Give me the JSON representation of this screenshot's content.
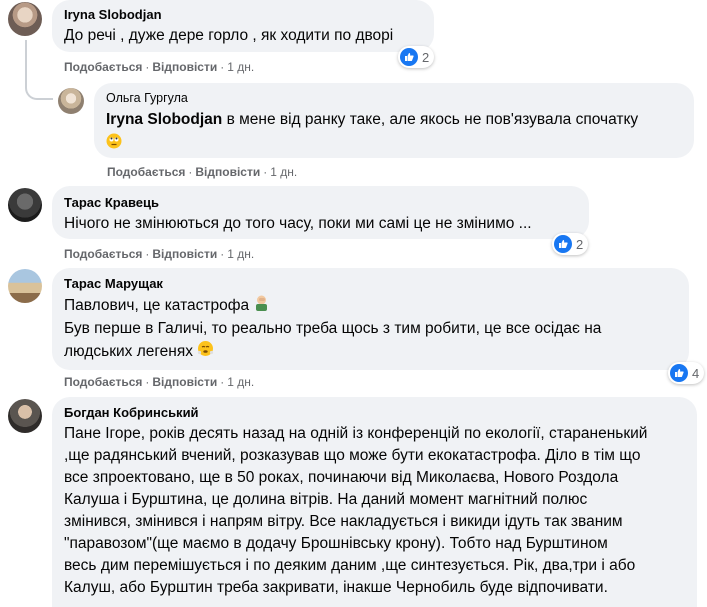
{
  "comments": [
    {
      "author": "Iryna Slobodjan",
      "lines": [
        "До речі , дуже дере горло , як ходити по дворі"
      ],
      "actions": {
        "like": "Подобається",
        "reply": "Відповісти",
        "time": "1 дн."
      },
      "reactions": "2"
    },
    {
      "author": "Ольга Гургула",
      "mention": "Iryna Slobodjan",
      "lines": [
        " в мене від ранку таке, але якось не пов'язувала спочатку"
      ],
      "emoji": "face-with-rolling-eyes-emoji",
      "actions": {
        "like": "Подобається",
        "reply": "Відповісти",
        "time": "1 дн."
      }
    },
    {
      "author": "Тарас Кравець",
      "lines": [
        "Нічого не змінюються до того часу, поки ми самі це не змінимо ..."
      ],
      "actions": {
        "like": "Подобається",
        "reply": "Відповісти",
        "time": "1 дн."
      },
      "reactions": "2"
    },
    {
      "author": "Тарас Марущак",
      "lines": [
        "Павлович, це катастрофа",
        "Був перше в Галичі, то реально треба щось з тим робити, це все осідає на",
        "людських легенях"
      ],
      "emojis": [
        "man-facepalming-emoji",
        "face-with-steam-emoji"
      ],
      "actions": {
        "like": "Подобається",
        "reply": "Відповісти",
        "time": "1 дн."
      },
      "reactions": "4"
    },
    {
      "author": "Богдан Кобринський",
      "lines": [
        "Пане Ігоре, років десять назад на одній із конференцій по екології, стараненький",
        ",ще радянський вчений, розказував що може бути екокатастрофа. Діло в тім що",
        "все зпроектовано, ще в 50 роках, починаючи від Миколаєва, Нового Роздола",
        "Калуша і Бурштина, це долина вітрів. На даний момент магнітний полюс",
        "змінився, змінився і напрям вітру. Все накладується і викиди ідуть так званим",
        "\"паравозом\"(ще маємо в додачу Брошнівську крону). Тобто над Бурштином",
        "весь дим перемішується і по деяким даним ,ще синтезується. Рік, два,три і або",
        "Калуш, або Бурштин треба закривати, інакше Чернобиль буде відпочивати."
      ]
    }
  ],
  "colors": {
    "bubble": "#f0f2f5",
    "meta": "#65676b",
    "like": "#1877f2"
  }
}
